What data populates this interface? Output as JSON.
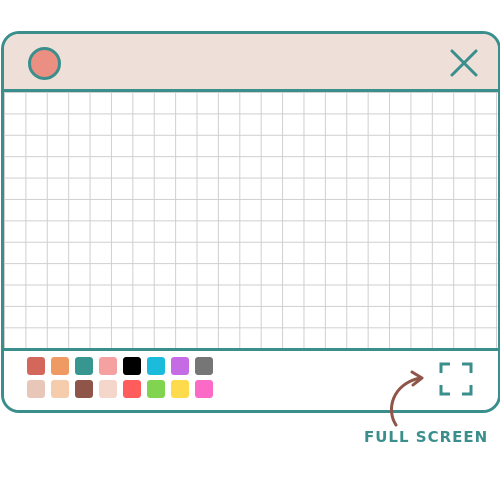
{
  "window": {
    "title_dot_color": "#ec8f83",
    "close_icon": "close-icon",
    "accent_color": "#3a8f8c",
    "titlebar_color": "#eee0d8"
  },
  "palette": {
    "colors": [
      "#d4675c",
      "#f09a63",
      "#379690",
      "#f5a0a1",
      "#000000",
      "#1bbbdc",
      "#c56be3",
      "#767676",
      "#e8c7b9",
      "#f6cdac",
      "#8f5548",
      "#f5d6ca",
      "#ff5c5c",
      "#80d450",
      "#fedb4d",
      "#fb6ac7"
    ]
  },
  "fullscreen": {
    "icon": "fullscreen-icon",
    "label": "FULL SCREEN"
  }
}
